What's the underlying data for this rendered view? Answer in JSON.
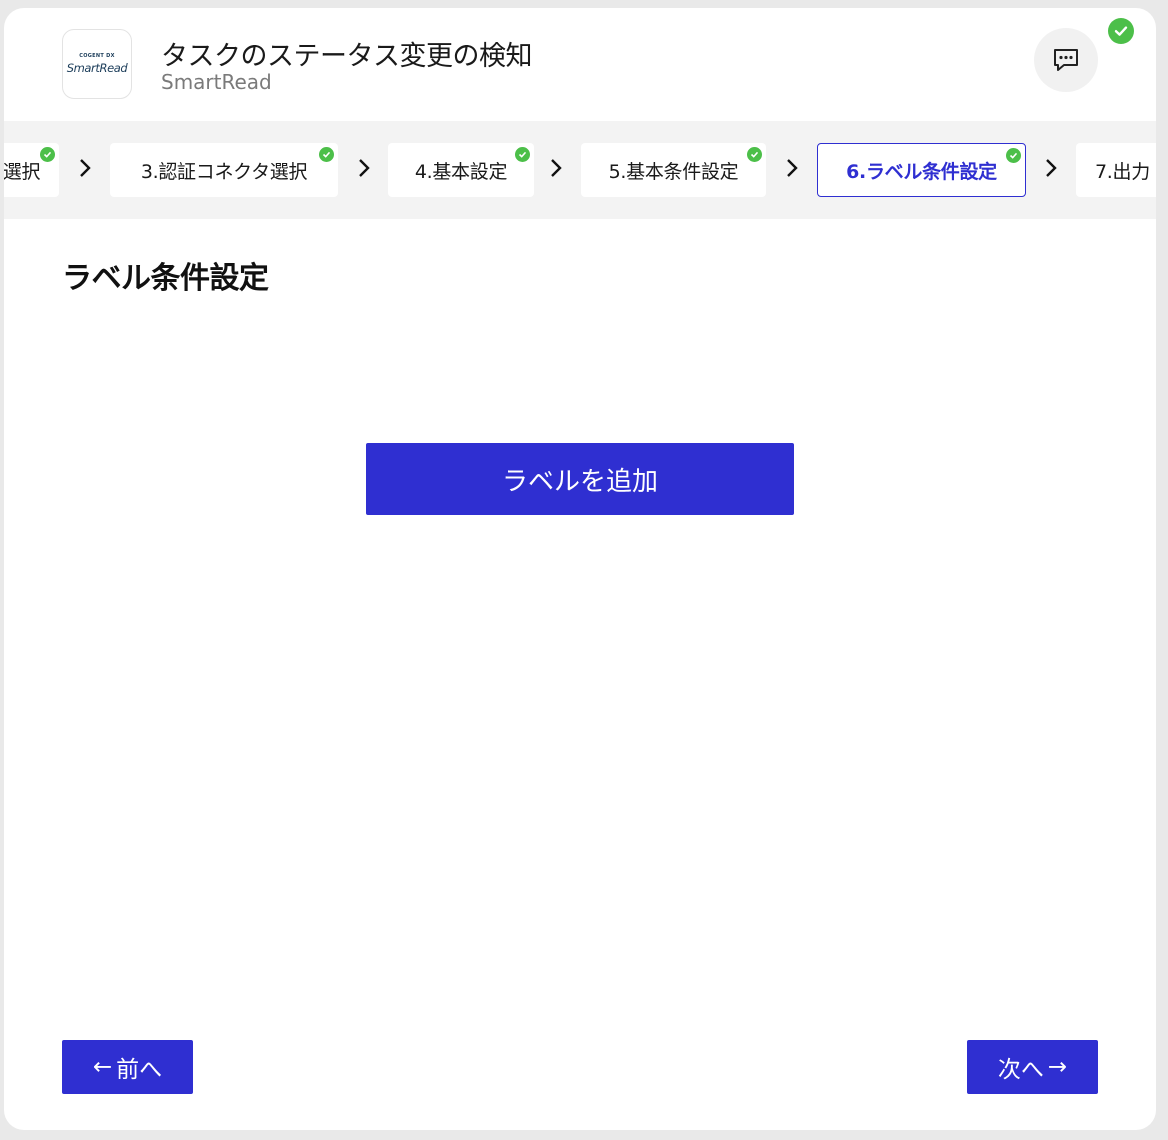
{
  "header": {
    "logo": {
      "brand": "COGENT DX",
      "name": "SmartRead"
    },
    "title": "タスクのステータス変更の検知",
    "subtitle": "SmartRead",
    "chat_icon": "chat-icon",
    "status_icon": "check-circle-icon"
  },
  "steps": [
    {
      "label": "選択",
      "completed": true,
      "active": false
    },
    {
      "label": "3.認証コネクタ選択",
      "completed": true,
      "active": false
    },
    {
      "label": "4.基本設定",
      "completed": true,
      "active": false
    },
    {
      "label": "5.基本条件設定",
      "completed": true,
      "active": false
    },
    {
      "label": "6.ラベル条件設定",
      "completed": true,
      "active": true
    },
    {
      "label": "7.出力",
      "completed": false,
      "active": false
    }
  ],
  "main": {
    "section_title": "ラベル条件設定",
    "add_label_button": "ラベルを追加"
  },
  "footer": {
    "prev_arrow": "←",
    "prev_label": "前へ",
    "next_label": "次へ",
    "next_arrow": "→"
  },
  "colors": {
    "accent": "#2f2fd1",
    "success": "#4cbf49",
    "step_bar": "#f3f3f3"
  }
}
